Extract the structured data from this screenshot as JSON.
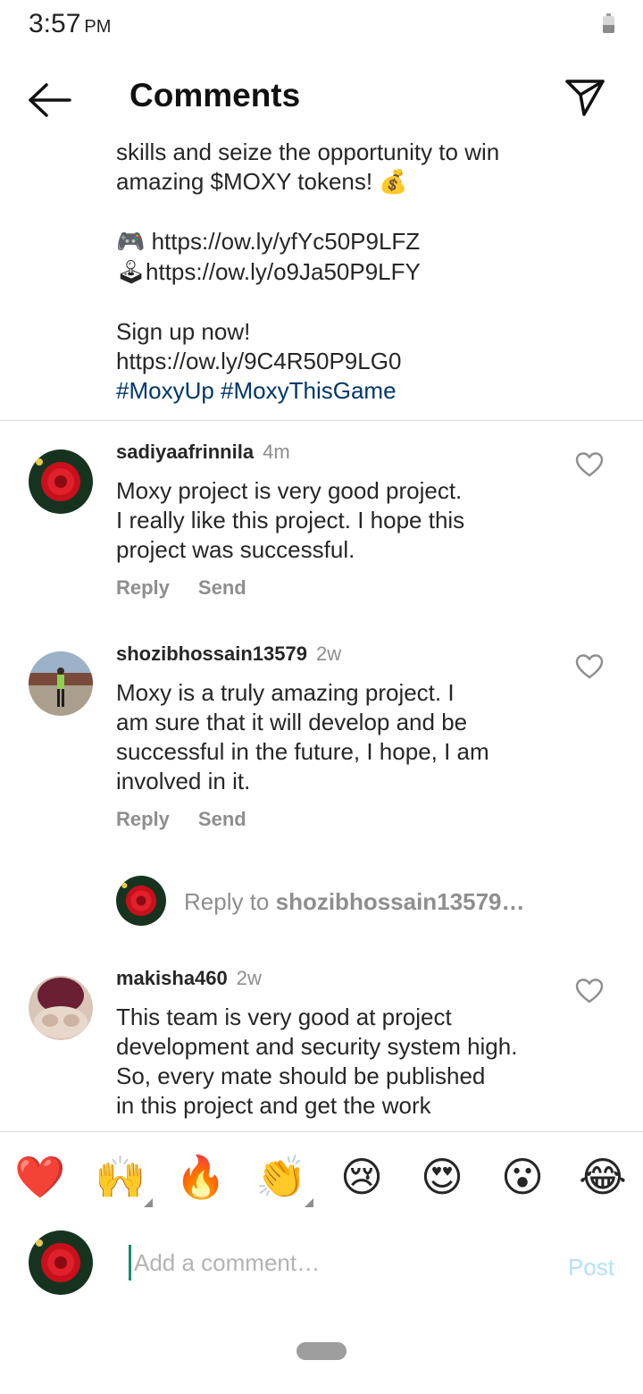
{
  "status": {
    "time": "3:57",
    "ampm": "PM"
  },
  "header": {
    "title": "Comments",
    "back_icon": "arrow-left-icon",
    "direct_icon": "paper-plane-icon"
  },
  "caption": {
    "line1": "skills and seize the opportunity to win",
    "line2": "amazing $MOXY tokens!",
    "money_emoji": "💰",
    "link1_emoji": "🎮",
    "link1": " https://ow.ly/yfYc50P9LFZ",
    "link2_emoji": "🕹",
    "link2": "https://ow.ly/o9Ja50P9LFY",
    "signup": "Sign up now!",
    "link3": "https://ow.ly/9C4R50P9LG0",
    "hashtags": "#MoxyUp #MoxyThisGame"
  },
  "comments": [
    {
      "username": "sadiyaafrinnila",
      "time": "4m",
      "lines": [
        "Moxy project is very good project.",
        "I really like this project. I hope this",
        "project was successful."
      ],
      "reply": "Reply",
      "send": "Send"
    },
    {
      "username": "shozibhossain13579",
      "time": "2w",
      "lines": [
        "Moxy is a truly amazing project. I",
        "am sure that it will develop and be",
        "successful in the future, I hope, I am",
        "involved in it."
      ],
      "reply": "Reply",
      "send": "Send"
    },
    {
      "username": "makisha460",
      "time": "2w",
      "lines": [
        "This team is very good at project",
        "development and security system high.",
        "So, every mate should be published",
        "in this project and get the work"
      ]
    }
  ],
  "reply_prompt": {
    "prefix": "Reply to ",
    "username": "shozibhossain13579…"
  },
  "reactions": [
    "❤️",
    "🙌",
    "🔥",
    "👏",
    "😢",
    "😍",
    "😮",
    "😂"
  ],
  "composer": {
    "placeholder": "Add a comment…",
    "post": "Post"
  },
  "colors": {
    "hashtag": "#00376b",
    "secondary_text": "#8e8e8e",
    "post_disabled": "#b2dffc"
  }
}
